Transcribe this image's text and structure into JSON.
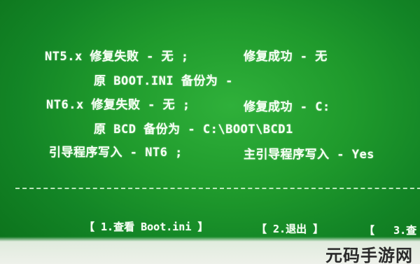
{
  "status_lines": {
    "nt5_fail": "NT5.x 修复失败 - 无 ;",
    "nt5_success": "修复成功 - 无",
    "boot_ini_backup": "原 BOOT.INI 备份为 -",
    "nt6_fail": "NT6.x 修复失败 - 无 ;",
    "nt6_success": "修复成功 - C:",
    "bcd_backup": "原 BCD 备份为 - C:\\BOOT\\BCD1",
    "boot_write": "引导程序写入 - NT6 ;",
    "main_boot_write": "主引导程序写入 - Yes"
  },
  "menu": {
    "item1": "【 1.查看 Boot.ini 】",
    "item2": "【 2.退出 】",
    "item3": "【   3.查"
  },
  "watermark": {
    "text": "元码手游网"
  },
  "colors": {
    "screen_green": "#1f9a2c",
    "text": "#f4fff2",
    "watermark_bg": "#eef1ea"
  }
}
